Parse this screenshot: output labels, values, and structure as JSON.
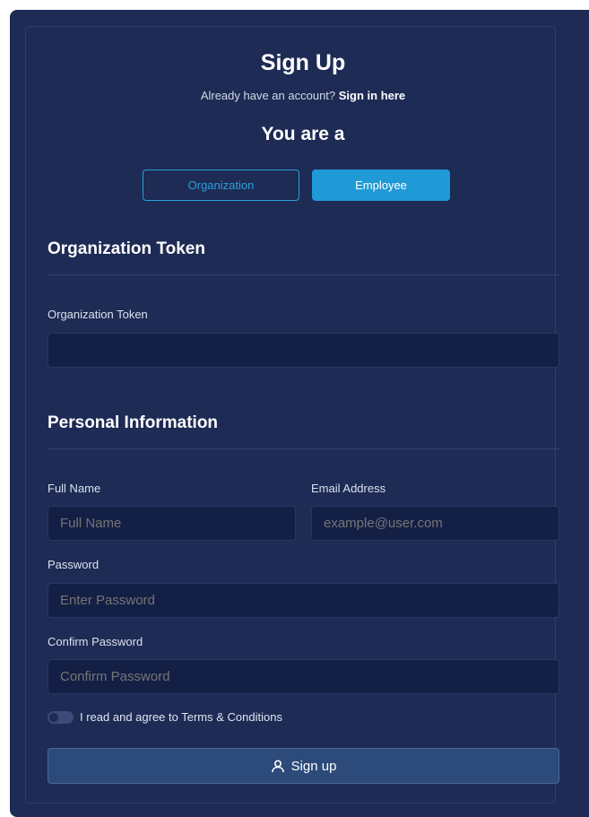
{
  "header": {
    "title": "Sign Up",
    "signin_prompt": "Already have an account?",
    "signin_link": "Sign in here",
    "role_heading": "You are a"
  },
  "roles": {
    "organization_label": "Organization",
    "employee_label": "Employee",
    "selected": "Employee"
  },
  "org_section": {
    "title": "Organization Token",
    "token_label": "Organization Token",
    "token_value": ""
  },
  "personal_section": {
    "title": "Personal Information",
    "full_name_label": "Full Name",
    "full_name_placeholder": "Full Name",
    "email_label": "Email Address",
    "email_placeholder": "example@user.com",
    "password_label": "Password",
    "password_placeholder": "Enter Password",
    "confirm_label": "Confirm Password",
    "confirm_placeholder": "Confirm Password"
  },
  "terms": {
    "label": "I read and agree to Terms & Conditions",
    "checked": false
  },
  "submit": {
    "label": "Sign up",
    "icon": "user-icon"
  },
  "colors": {
    "background": "#1d2b55",
    "input_bg": "#141f45",
    "accent": "#1f9ad6",
    "button_bg": "#2c4a7a"
  }
}
